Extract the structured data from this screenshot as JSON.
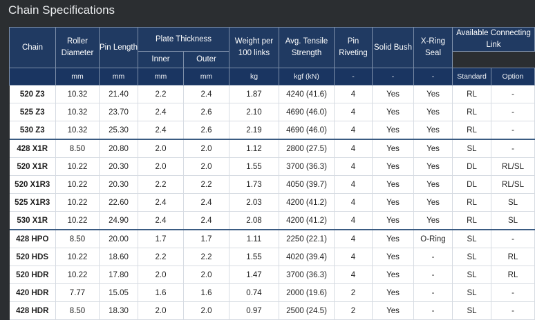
{
  "title": "Chain Specifications",
  "headers": {
    "chain": "Chain",
    "roller_diameter": "Roller Diameter",
    "pin_length": "Pin Length",
    "plate_thickness": "Plate Thickness",
    "inner": "Inner",
    "outer": "Outer",
    "weight": "Weight per 100 links",
    "tensile": "Avg. Tensile Strength",
    "pin_riveting": "Pin Riveting",
    "solid_bush": "Solid Bush",
    "xring_seal": "X-Ring Seal",
    "available_link": "Available Connecting Link"
  },
  "units": [
    "",
    "mm",
    "mm",
    "mm",
    "mm",
    "kg",
    "kgf (kN)",
    "-",
    "-",
    "-",
    "Standard",
    "Option"
  ],
  "rows": [
    [
      "520 Z3",
      "10.32",
      "21.40",
      "2.2",
      "2.4",
      "1.87",
      "4240 (41.6)",
      "4",
      "Yes",
      "Yes",
      "RL",
      "-"
    ],
    [
      "525 Z3",
      "10.32",
      "23.70",
      "2.4",
      "2.6",
      "2.10",
      "4690 (46.0)",
      "4",
      "Yes",
      "Yes",
      "RL",
      "-"
    ],
    [
      "530 Z3",
      "10.32",
      "25.30",
      "2.4",
      "2.6",
      "2.19",
      "4690 (46.0)",
      "4",
      "Yes",
      "Yes",
      "RL",
      "-"
    ],
    [
      "428 X1R",
      "8.50",
      "20.80",
      "2.0",
      "2.0",
      "1.12",
      "2800 (27.5)",
      "4",
      "Yes",
      "Yes",
      "SL",
      "-"
    ],
    [
      "520 X1R",
      "10.22",
      "20.30",
      "2.0",
      "2.0",
      "1.55",
      "3700 (36.3)",
      "4",
      "Yes",
      "Yes",
      "DL",
      "RL/SL"
    ],
    [
      "520 X1R3",
      "10.22",
      "20.30",
      "2.2",
      "2.2",
      "1.73",
      "4050 (39.7)",
      "4",
      "Yes",
      "Yes",
      "DL",
      "RL/SL"
    ],
    [
      "525 X1R3",
      "10.22",
      "22.60",
      "2.4",
      "2.4",
      "2.03",
      "4200 (41.2)",
      "4",
      "Yes",
      "Yes",
      "RL",
      "SL"
    ],
    [
      "530 X1R",
      "10.22",
      "24.90",
      "2.4",
      "2.4",
      "2.08",
      "4200 (41.2)",
      "4",
      "Yes",
      "Yes",
      "RL",
      "SL"
    ],
    [
      "428 HPO",
      "8.50",
      "20.00",
      "1.7",
      "1.7",
      "1.11",
      "2250 (22.1)",
      "4",
      "Yes",
      "O-Ring",
      "SL",
      "-"
    ],
    [
      "520 HDS",
      "10.22",
      "18.60",
      "2.2",
      "2.2",
      "1.55",
      "4020 (39.4)",
      "4",
      "Yes",
      "-",
      "SL",
      "RL"
    ],
    [
      "520 HDR",
      "10.22",
      "17.80",
      "2.0",
      "2.0",
      "1.47",
      "3700 (36.3)",
      "4",
      "Yes",
      "-",
      "SL",
      "RL"
    ],
    [
      "420 HDR",
      "7.77",
      "15.05",
      "1.6",
      "1.6",
      "0.74",
      "2000 (19.6)",
      "2",
      "Yes",
      "-",
      "SL",
      "-"
    ],
    [
      "428 HDR",
      "8.50",
      "18.30",
      "2.0",
      "2.0",
      "0.97",
      "2500 (24.5)",
      "2",
      "Yes",
      "-",
      "SL",
      "-"
    ]
  ]
}
